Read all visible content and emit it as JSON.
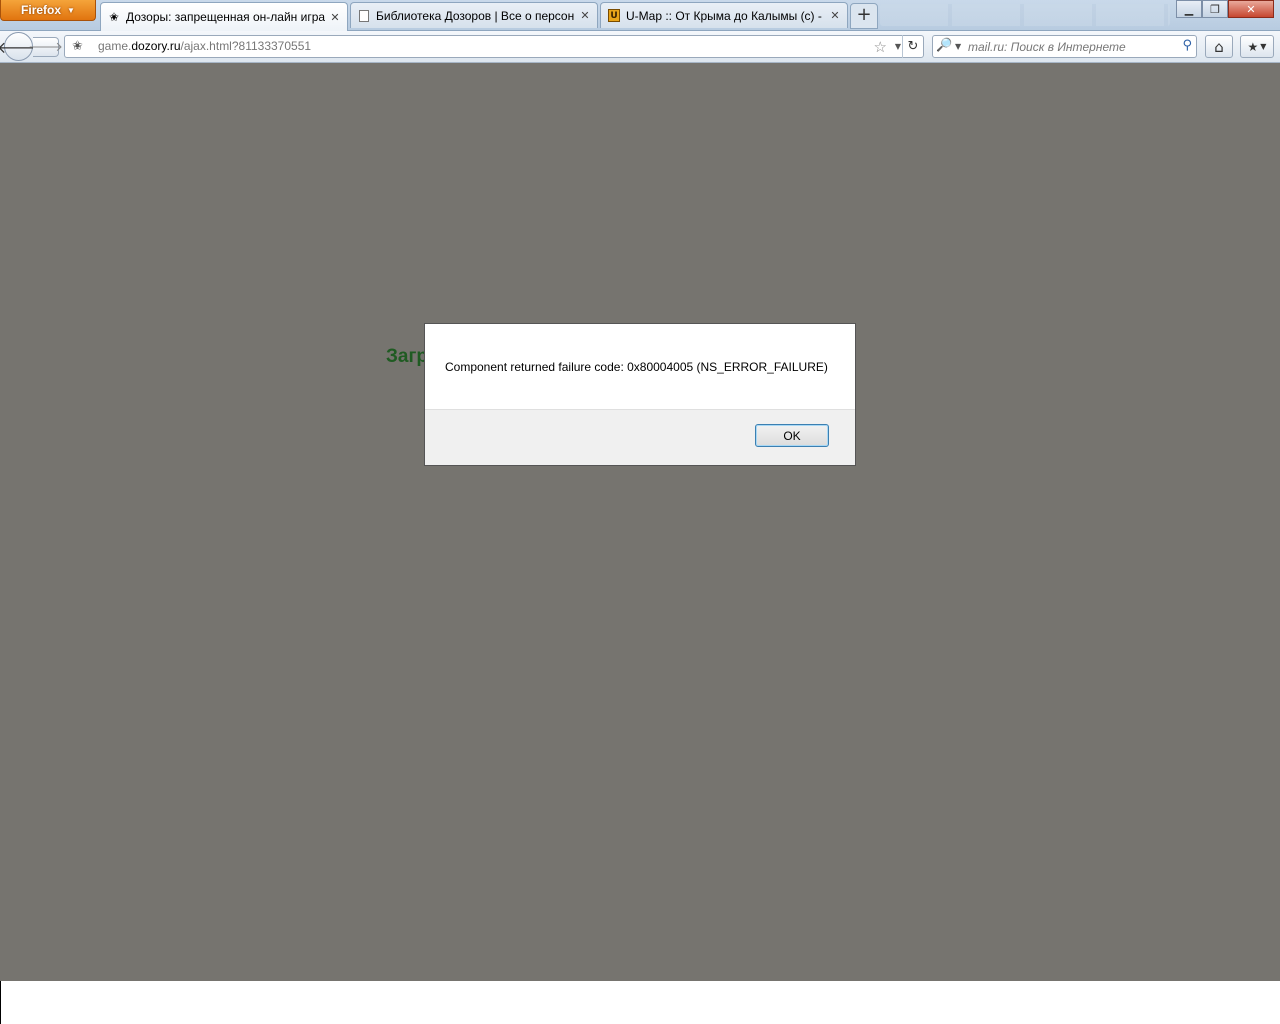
{
  "browser": {
    "app_button_label": "Firefox",
    "tabs": [
      {
        "title": "Дозоры: запрещенная он-лайн игра",
        "active": true
      },
      {
        "title": "Библиотека Дозоров | Все о персон...",
        "active": false
      },
      {
        "title": "U-Map :: От Крыма до Калымы (с) - ...",
        "active": false
      }
    ],
    "new_tab_label": "+",
    "url": {
      "prefix": "game.",
      "domain": "dozory.ru",
      "path": "/ajax.html?81133370551"
    },
    "search_placeholder": "mail.ru: Поиск в Интернете"
  },
  "page": {
    "loading_text": "Загрузка"
  },
  "dialog": {
    "message": "Component returned failure code: 0x80004005 (NS_ERROR_FAILURE)",
    "ok_label": "OK"
  },
  "colors": {
    "content_background": "#76746f",
    "loading_text": "#1f5b22",
    "firefox_button": "#e8841e"
  }
}
